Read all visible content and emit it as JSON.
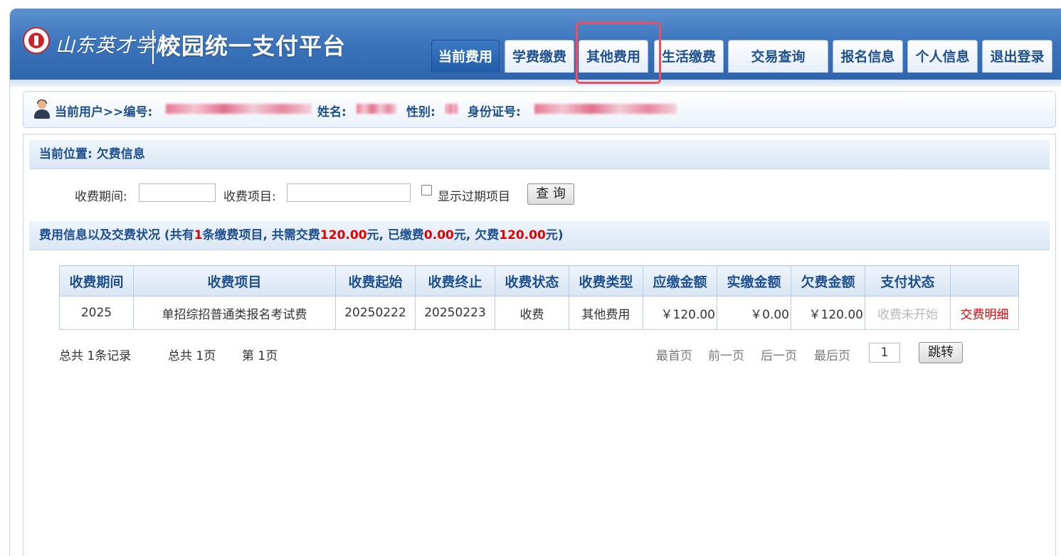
{
  "header": {
    "school_name": "山东英才学院",
    "platform_name": "校园统一支付平台"
  },
  "nav": {
    "items": [
      {
        "label": "当前费用",
        "active": true
      },
      {
        "label": "学费缴费"
      },
      {
        "label": "其他费用",
        "highlighted": true
      },
      {
        "label": "生活缴费"
      },
      {
        "label": "交易查询"
      },
      {
        "label": "报名信息"
      },
      {
        "label": "个人信息"
      },
      {
        "label": "退出登录"
      }
    ]
  },
  "user_bar": {
    "prefix": "当前用户>>编号:",
    "name_label": "姓名:",
    "gender_label": "性别:",
    "id_label": "身份证号:",
    "redacted": true
  },
  "location": {
    "text": "当前位置: 欠费信息"
  },
  "filters": {
    "period_label": "收费期间:",
    "period_value": "",
    "item_label": "收费项目:",
    "item_value": "",
    "show_expired_label": "显示过期项目",
    "show_expired_checked": false,
    "query_button": "查 询"
  },
  "summary": {
    "prefix": "费用信息以及交费状况 (共有",
    "count": "1",
    "mid1": "条缴费项目, 共需交费",
    "total": "120.00",
    "mid2": "元, 已缴费",
    "paid": "0.00",
    "mid3": "元, 欠费",
    "owed": "120.00",
    "suffix": "元)"
  },
  "table": {
    "headers": [
      "收费期间",
      "收费项目",
      "收费起始",
      "收费终止",
      "收费状态",
      "收费类型",
      "应缴金额",
      "实缴金额",
      "欠费金额",
      "支付状态",
      ""
    ],
    "rows": [
      {
        "period": "2025",
        "item": "单招综招普通类报名考试费",
        "start": "20250222",
        "end": "20250223",
        "status": "收费",
        "type": "其他费用",
        "due": "￥120.00",
        "paid": "￥0.00",
        "owed": "￥120.00",
        "pay_status": "收费未开始",
        "action": "交费明细"
      }
    ]
  },
  "pager": {
    "total_records": "总共 1条记录",
    "total_pages": "总共 1页",
    "current_page": "第 1页",
    "first": "最首页",
    "prev": "前一页",
    "next": "后一页",
    "last": "最后页",
    "page_input": "1",
    "jump_button": "跳转"
  },
  "colors": {
    "header_blue": "#3d76bd",
    "title_blue": "#1e4f8f",
    "accent_red": "#e00000",
    "highlight_box": "#ee4f5f"
  }
}
